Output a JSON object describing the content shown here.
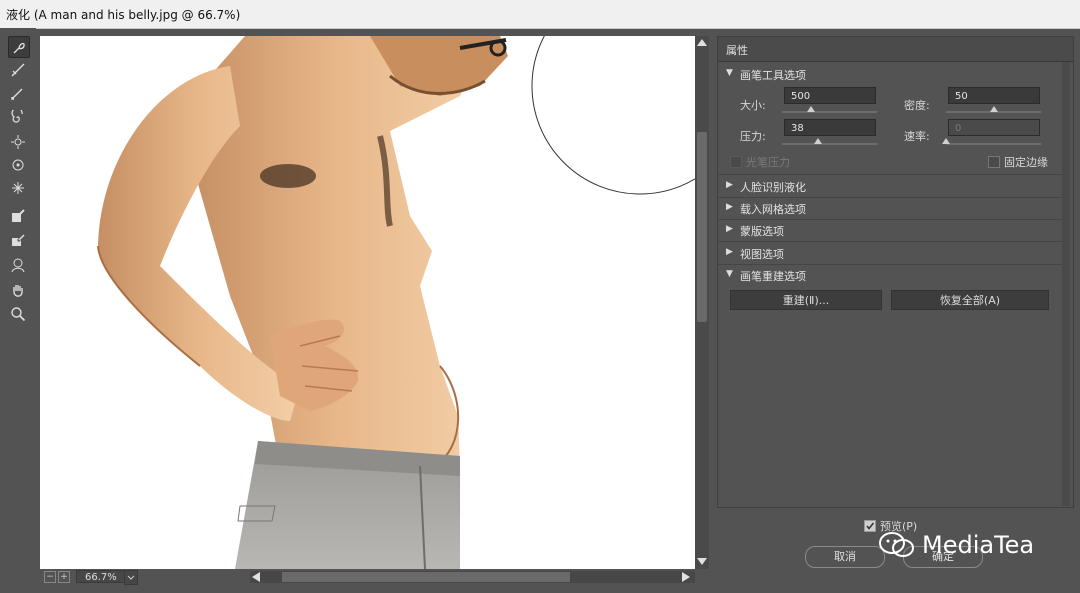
{
  "window": {
    "title": "液化 (A man and his belly.jpg @ 66.7%)"
  },
  "tools": [
    {
      "name": "forward-warp-tool-icon",
      "selected": true
    },
    {
      "name": "reconstruct-tool-icon"
    },
    {
      "name": "smooth-tool-icon"
    },
    {
      "name": "twirl-tool-icon"
    },
    {
      "name": "pucker-tool-icon"
    },
    {
      "name": "bloat-tool-icon"
    },
    {
      "name": "push-left-tool-icon"
    },
    {
      "name": "freeze-mask-tool-icon"
    },
    {
      "name": "thaw-mask-tool-icon"
    },
    {
      "name": "face-tool-icon"
    },
    {
      "name": "hand-tool-icon"
    },
    {
      "name": "zoom-tool-icon"
    }
  ],
  "status": {
    "zoom": "66.7%",
    "minus": "−",
    "plus": "+"
  },
  "panel": {
    "title": "属性",
    "brush_section": "画笔工具选项",
    "size_label": "大小:",
    "size_value": "500",
    "size_level": 0.3,
    "density_label": "密度:",
    "density_value": "50",
    "density_level": 0.5,
    "pressure_label": "压力:",
    "pressure_value": "38",
    "pressure_level": 0.38,
    "rate_label": "速率:",
    "rate_value": "0",
    "rate_level": 0.0,
    "stylus_label": "光笔压力",
    "pin_edges_label": "固定边缘",
    "sections": [
      "人脸识别液化",
      "载入网格选项",
      "蒙版选项",
      "视图选项"
    ],
    "reconstruct_section": "画笔重建选项",
    "reconstruct_button": "重建(Ⅱ)...",
    "restore_all_button": "恢复全部(A)"
  },
  "footer": {
    "preview_label": "预览(P)",
    "cancel_label": "取消",
    "ok_label": "确定"
  },
  "watermark": {
    "text": "MediaTea"
  },
  "colors": {
    "bg": "#535353",
    "panel": "#535353",
    "field": "#3a3a3a",
    "canvas": "#ffffff"
  }
}
